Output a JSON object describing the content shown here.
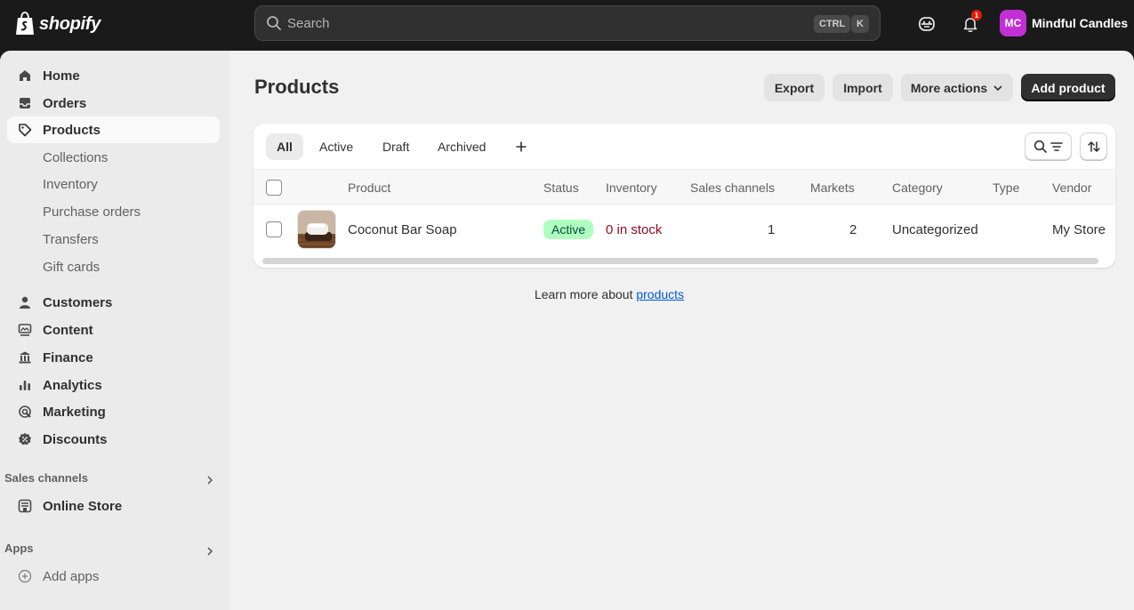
{
  "app": {
    "logo_text": "shopify"
  },
  "search": {
    "placeholder": "Search",
    "kbd_ctrl": "CTRL",
    "kbd_k": "K"
  },
  "header": {
    "notification_count": "1",
    "store_initials": "MC",
    "store_name": "Mindful Candles"
  },
  "sidebar": {
    "items": [
      {
        "label": "Home",
        "icon": "home-icon"
      },
      {
        "label": "Orders",
        "icon": "inbox-icon"
      },
      {
        "label": "Products",
        "icon": "tag-icon",
        "selected": true
      }
    ],
    "product_sub": [
      "Collections",
      "Inventory",
      "Purchase orders",
      "Transfers",
      "Gift cards"
    ],
    "items2": [
      {
        "label": "Customers",
        "icon": "person-icon"
      },
      {
        "label": "Content",
        "icon": "content-icon"
      },
      {
        "label": "Finance",
        "icon": "bank-icon"
      },
      {
        "label": "Analytics",
        "icon": "bar-chart-icon"
      },
      {
        "label": "Marketing",
        "icon": "target-icon"
      },
      {
        "label": "Discounts",
        "icon": "discount-icon"
      }
    ],
    "sales_channels_heading": "Sales channels",
    "online_store": "Online Store",
    "apps_heading": "Apps",
    "add_apps": "Add apps"
  },
  "page": {
    "title": "Products",
    "export": "Export",
    "import": "Import",
    "more_actions": "More actions",
    "add_product": "Add product"
  },
  "tabs": [
    "All",
    "Active",
    "Draft",
    "Archived"
  ],
  "table": {
    "columns": [
      "Product",
      "Status",
      "Inventory",
      "Sales channels",
      "Markets",
      "Category",
      "Type",
      "Vendor"
    ],
    "rows": [
      {
        "product": "Coconut Bar Soap",
        "status": "Active",
        "inventory": "0 in stock",
        "sales_channels": "1",
        "markets": "2",
        "category": "Uncategorized",
        "type": "",
        "vendor": "My Store"
      }
    ]
  },
  "footer": {
    "learn_prefix": "Learn more about ",
    "learn_link": "products"
  },
  "colors": {
    "accent_dark": "#303030",
    "active_badge": "#affebf",
    "inventory_red": "#8e0b21",
    "link": "#005bd3",
    "avatar": "#c22fd4"
  }
}
